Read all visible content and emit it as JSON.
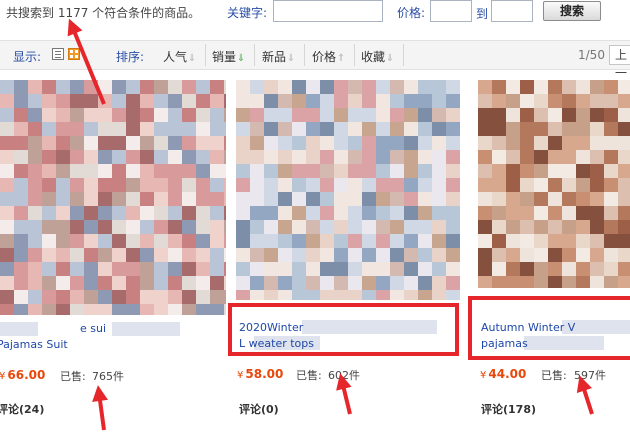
{
  "search_bar": {
    "result_text": "共搜索到 1177 个符合条件的商品。",
    "keyword_label": "关键字:",
    "keyword_value": "",
    "price_label": "价格:",
    "price_min": "",
    "to_label": "到",
    "price_max": "",
    "search_button": "搜索"
  },
  "sort_bar": {
    "display_label": "显示:",
    "sort_label": "排序:",
    "options": [
      {
        "label": "人气",
        "arrow": "⇓",
        "active": false
      },
      {
        "label": "销量",
        "arrow": "⇓",
        "active": true
      },
      {
        "label": "新品",
        "arrow": "⇓",
        "active": false
      },
      {
        "label": "价格",
        "arrow": "⇑",
        "active": false
      },
      {
        "label": "收藏",
        "arrow": "⇓",
        "active": false
      }
    ],
    "page_indicator": "1/50",
    "prev_page": "上一"
  },
  "products": [
    {
      "title_line1": "e sui",
      "title_line2": "Pajamas Suit",
      "yen": "¥",
      "price": "66.00",
      "sold_label": "已售:",
      "sold": "765件",
      "reviews": "评论(24)"
    },
    {
      "title_line1": "2020Winter",
      "title_line2": "L         weater tops",
      "yen": "¥",
      "price": "58.00",
      "sold_label": "已售:",
      "sold": "602件",
      "reviews": "评论(0)"
    },
    {
      "title_line1": "Autumn Winter V",
      "title_line2": "pajamas",
      "yen": "¥",
      "price": "44.00",
      "sold_label": "已售:",
      "sold": "597件",
      "reviews": "评论(178)"
    }
  ],
  "colors": {
    "annotation_red": "#e5262b",
    "price_orange": "#e8470a",
    "link_blue": "#1e48a8",
    "sales_green": "#4caf50"
  }
}
